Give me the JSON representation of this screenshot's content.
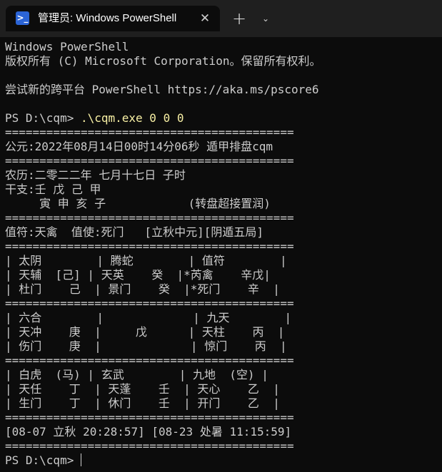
{
  "window": {
    "tab_title": "管理员: Windows PowerShell",
    "tab_icon": "powershell-icon",
    "close_icon": "close-icon",
    "new_tab_icon": "plus-icon",
    "dropdown_icon": "chevron-down-icon"
  },
  "colors": {
    "background": "#0c0c0c",
    "titlebar": "#1f1f1f",
    "text": "#cccccc",
    "command": "#f9f1a5",
    "icon_accent": "#2b64d6"
  },
  "terminal": {
    "lines": [
      "Windows PowerShell",
      "版权所有 (C) Microsoft Corporation。保留所有权利。",
      "",
      "尝试新的跨平台 PowerShell https://aka.ms/pscore6",
      "",
      "",
      "==========================================",
      "公元:2022年08月14日00时14分06秒 遁甲排盘cqm",
      "==========================================",
      "农历:二零二二年 七月十七日 子时",
      "干支:壬 戊 己 甲",
      "     寅 申 亥 子            (转盘超接置润)",
      "==========================================",
      "值符:天禽  值使:死门   [立秋中元][阴遁五局]",
      "==========================================",
      "| 太阴        | 腾蛇        | 值符        |",
      "| 天辅  [己] | 天英    癸  |*芮禽    辛戊|",
      "| 杜门    己  | 景门    癸  |*死门    辛  |",
      "==========================================",
      "| 六合        |             | 九天        |",
      "| 天冲    庚  |     戊      | 天柱    丙  |",
      "| 伤门    庚  |             | 惊门    丙  |",
      "==========================================",
      "| 白虎  (马) | 玄武        | 九地  (空) |",
      "| 天任    丁  | 天蓬    壬  | 天心    乙  |",
      "| 生门    丁  | 休门    壬  | 开门    乙  |",
      "==========================================",
      "[08-07 立秋 20:28:57] [08-23 处暑 11:15:59]",
      "=========================================="
    ],
    "command_prompt": "PS D:\\cqm> ",
    "command": ".\\cqm.exe 0 0 0",
    "current_prompt": "PS D:\\cqm> "
  }
}
